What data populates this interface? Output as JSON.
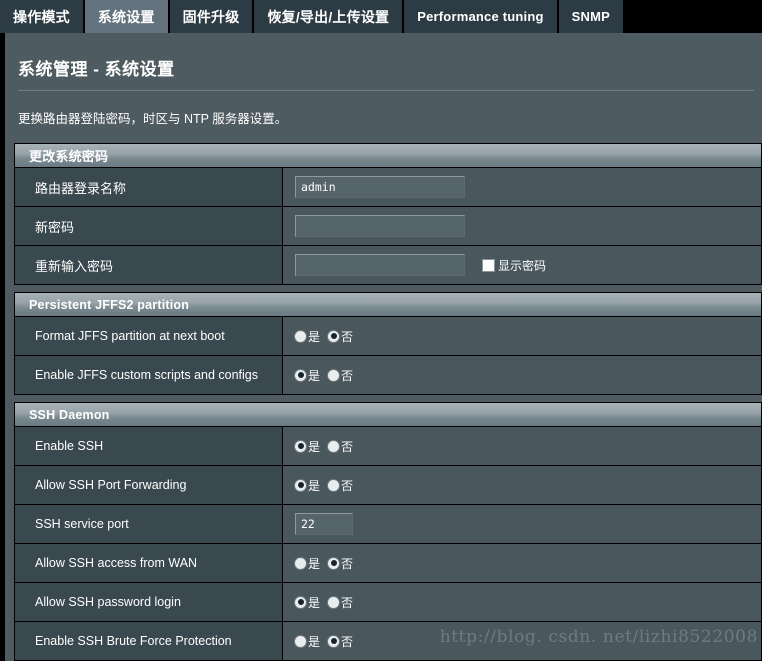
{
  "tabs": [
    {
      "label": "操作模式",
      "active": false,
      "cjk": true
    },
    {
      "label": "系统设置",
      "active": true,
      "cjk": true
    },
    {
      "label": "固件升级",
      "active": false,
      "cjk": true
    },
    {
      "label": "恢复/导出/上传设置",
      "active": false,
      "cjk": true
    },
    {
      "label": "Performance tuning",
      "active": false,
      "cjk": false
    },
    {
      "label": "SNMP",
      "active": false,
      "cjk": false
    }
  ],
  "page": {
    "title": "系统管理 - 系统设置",
    "description": "更换路由器登陆密码，时区与 NTP 服务器设置。"
  },
  "labels": {
    "yes": "是",
    "no": "否"
  },
  "sections": [
    {
      "heading": "更改系统密码",
      "heading_cjk": true,
      "rows": [
        {
          "label": "路由器登录名称",
          "cjk": true,
          "widget": "text",
          "value": "admin",
          "placeholder": ""
        },
        {
          "label": "新密码",
          "cjk": true,
          "widget": "text",
          "value": "",
          "placeholder": ""
        },
        {
          "label": "重新输入密码",
          "cjk": true,
          "widget": "text-check",
          "value": "",
          "placeholder": "",
          "checkbox_label": "显示密码",
          "checked": false
        }
      ]
    },
    {
      "heading": "Persistent JFFS2 partition",
      "heading_cjk": false,
      "rows": [
        {
          "label": "Format JFFS partition at next boot",
          "cjk": false,
          "widget": "radio",
          "selected": "no"
        },
        {
          "label": "Enable JFFS custom scripts and configs",
          "cjk": false,
          "widget": "radio",
          "selected": "yes"
        }
      ]
    },
    {
      "heading": "SSH Daemon",
      "heading_cjk": false,
      "rows": [
        {
          "label": "Enable SSH",
          "cjk": false,
          "widget": "radio",
          "selected": "yes"
        },
        {
          "label": "Allow SSH Port Forwarding",
          "cjk": false,
          "widget": "radio",
          "selected": "yes"
        },
        {
          "label": "SSH service port",
          "cjk": false,
          "widget": "port",
          "value": "22",
          "placeholder": ""
        },
        {
          "label": "Allow SSH access from WAN",
          "cjk": false,
          "widget": "radio",
          "selected": "no"
        },
        {
          "label": "Allow SSH password login",
          "cjk": false,
          "widget": "radio",
          "selected": "yes"
        },
        {
          "label": "Enable SSH Brute Force Protection",
          "cjk": false,
          "widget": "radio",
          "selected": "no"
        }
      ]
    }
  ],
  "watermark": "http://blog. csdn. net/lizhi8522008"
}
